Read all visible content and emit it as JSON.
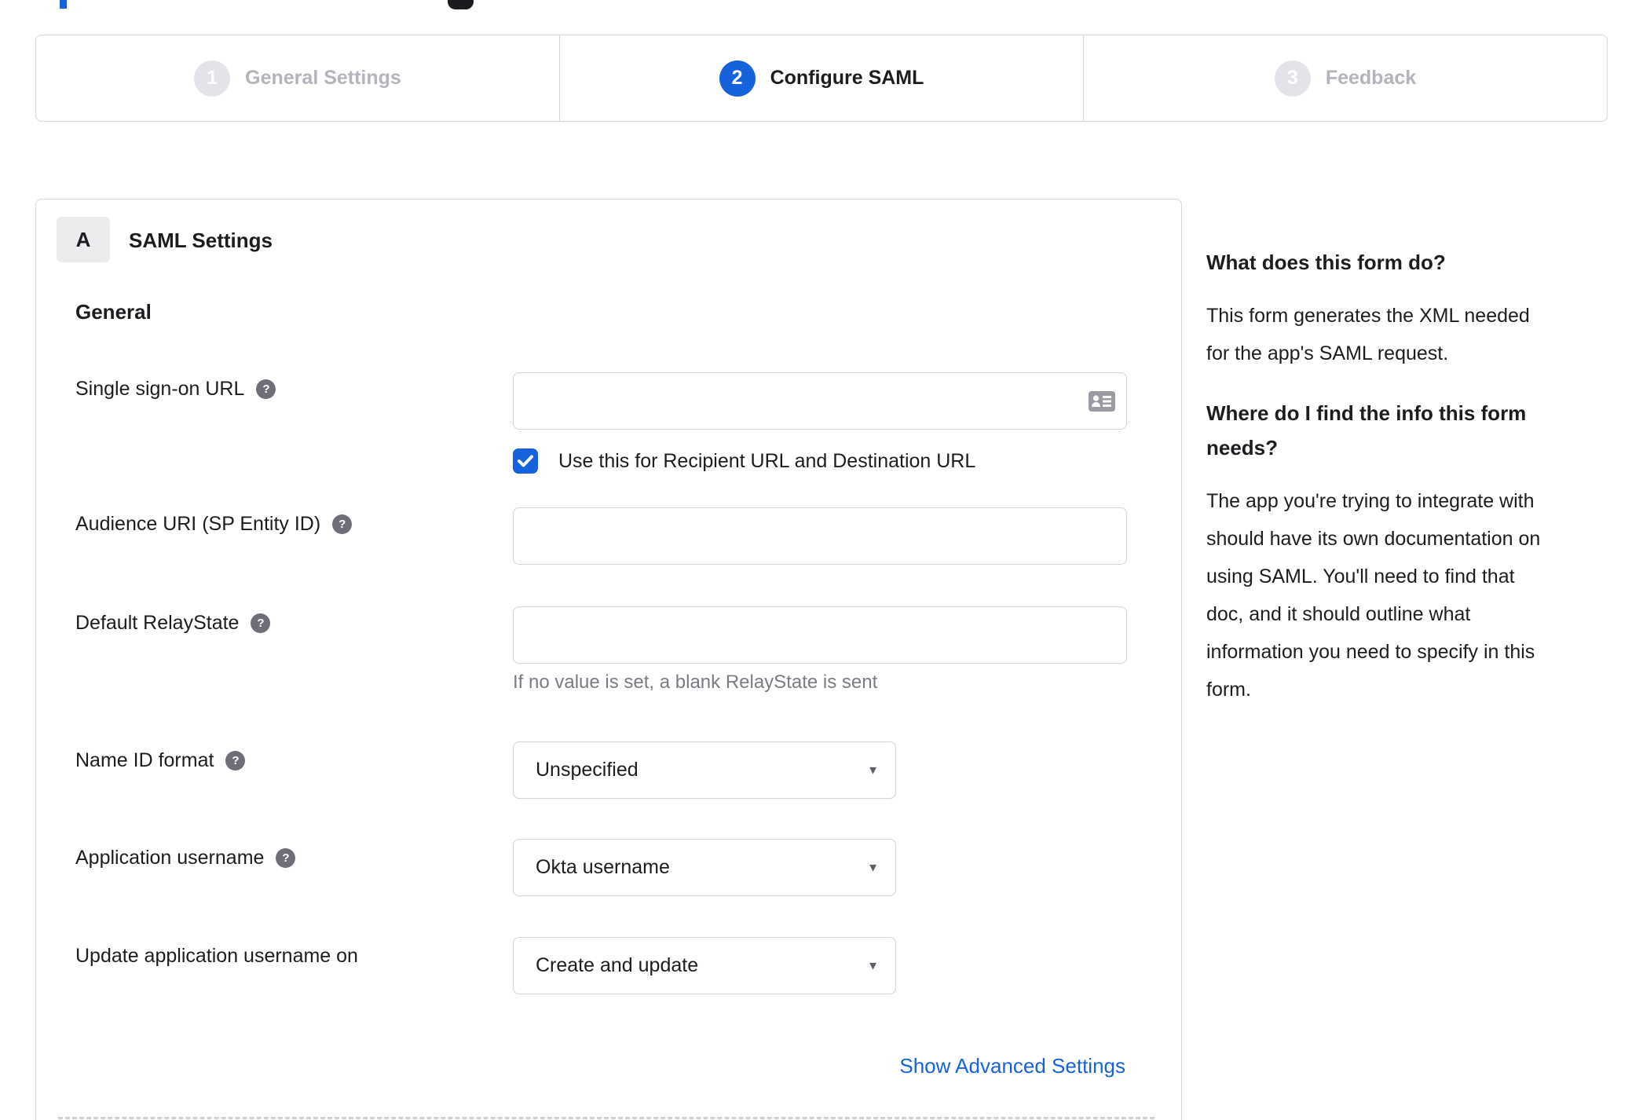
{
  "colors": {
    "accent_blue": "#1662dd",
    "link_blue": "#1662dd"
  },
  "icons": {
    "help_glyph": "?",
    "caret_glyph": "▼"
  },
  "stepper": {
    "steps": [
      {
        "number": "1",
        "label": "General Settings",
        "state": "inactive"
      },
      {
        "number": "2",
        "label": "Configure SAML",
        "state": "active"
      },
      {
        "number": "3",
        "label": "Feedback",
        "state": "inactive"
      }
    ]
  },
  "panel": {
    "badge": "A",
    "title": "SAML Settings",
    "section": "General",
    "fields": [
      {
        "label": "Single sign-on URL",
        "type": "text",
        "value": "",
        "checkbox_checked": true,
        "checkbox_label": "Use this for Recipient URL and Destination URL"
      },
      {
        "label": "Audience URI (SP Entity ID)",
        "type": "text",
        "value": ""
      },
      {
        "label": "Default RelayState",
        "type": "text",
        "value": "",
        "hint": "If no value is set, a blank RelayState is sent"
      },
      {
        "label": "Name ID format",
        "type": "select",
        "value": "Unspecified"
      },
      {
        "label": "Application username",
        "type": "select",
        "value": "Okta username"
      },
      {
        "label": "Update application username on",
        "type": "select",
        "value": "Create and update"
      }
    ],
    "advanced_link": "Show Advanced Settings"
  },
  "sidebar": {
    "heading1": "What does this form do?",
    "para1_lines": [
      "This form generates the XML needed",
      "for the app's SAML request."
    ],
    "heading2_lines": [
      "Where do I find the info this form",
      "needs?"
    ],
    "para2_lines": [
      "The app you're trying to integrate with",
      "should have its own documentation on",
      "using SAML. You'll need to find that",
      "doc, and it should outline what",
      "information you need to specify in this",
      "form."
    ]
  }
}
